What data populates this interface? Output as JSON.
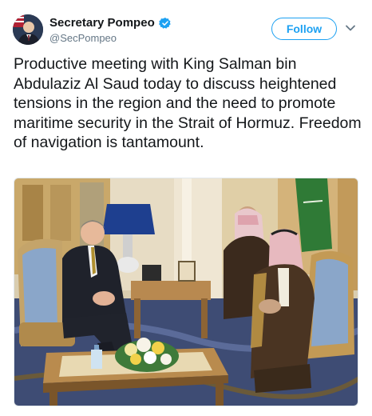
{
  "tweet": {
    "display_name": "Secretary Pompeo",
    "handle": "@SecPompeo",
    "follow_label": "Follow",
    "text": "Productive meeting with King Salman bin Abdulaziz Al Saud today to discuss heightened tensions in the region and the need to promote maritime security in the Strait of Hormuz. Freedom of navigation is tantamount."
  },
  "icons": {
    "verified": "verified-badge-icon",
    "more": "chevron-down-icon"
  },
  "colors": {
    "accent": "#1da1f2",
    "text": "#14171a",
    "secondary": "#657786"
  }
}
